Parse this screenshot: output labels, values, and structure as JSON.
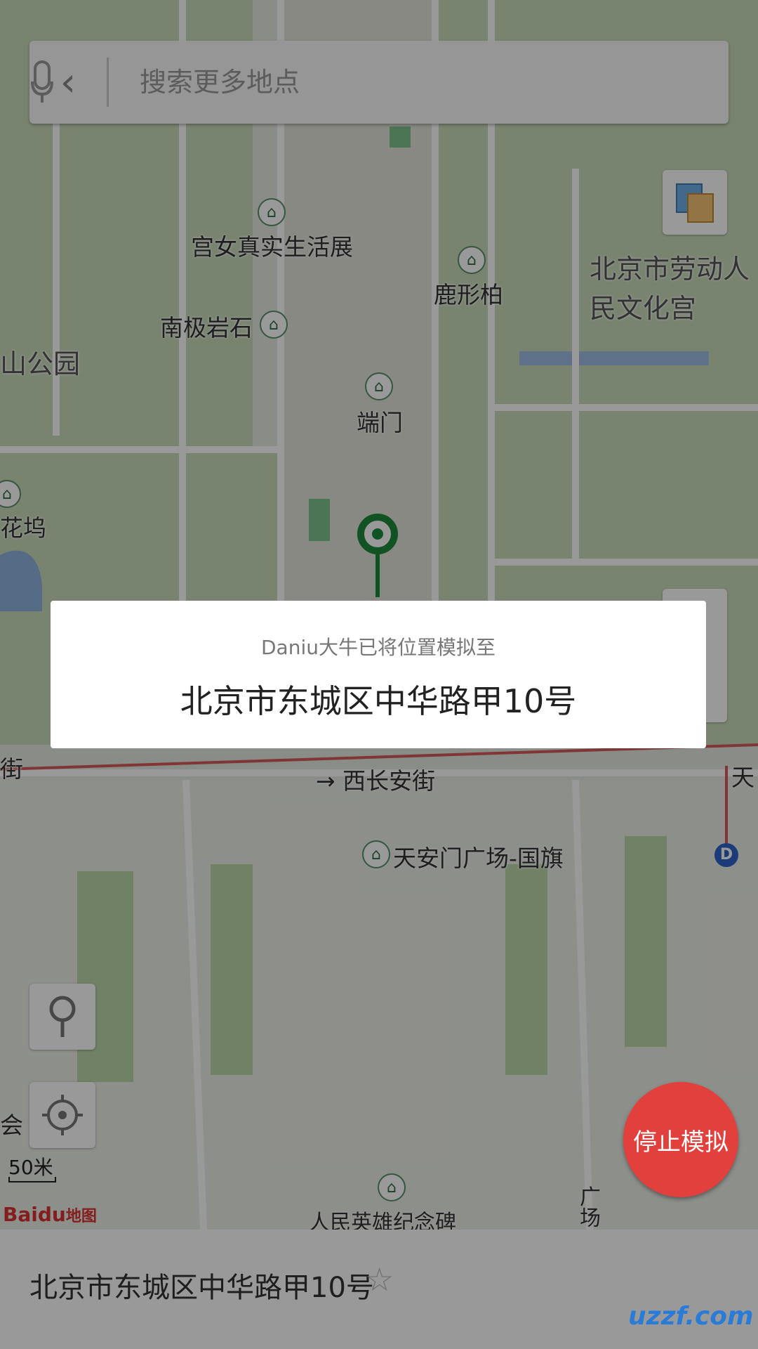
{
  "search": {
    "placeholder": "搜索更多地点"
  },
  "map": {
    "labels": {
      "gongnv": "宫女真实生活展",
      "luxingbai": "鹿形柏",
      "laodong": "北京市劳动人民文化宫",
      "nanji": "南极岩石",
      "shangongyuan": "山公园",
      "duanmen": "端门",
      "huawu": "花坞",
      "jie": "街",
      "xichangan": "→ 西长安街",
      "tiananmen": "天安门广场-国旗",
      "tian": "天",
      "hui": "会",
      "renmin": "人民英雄纪念碑",
      "guangchang": "广场",
      "d_marker": "D"
    },
    "scale": "50米",
    "logo_text": "Baidu",
    "logo_cn": "地图"
  },
  "dialog": {
    "subtitle": "Daniu大牛已将位置模拟至",
    "address": "北京市东城区中华路甲10号"
  },
  "stop_button": "停止模拟",
  "bottom_bar": {
    "address": "北京市东城区中华路甲10号",
    "star": "☆"
  },
  "watermark": "uzzf.com"
}
